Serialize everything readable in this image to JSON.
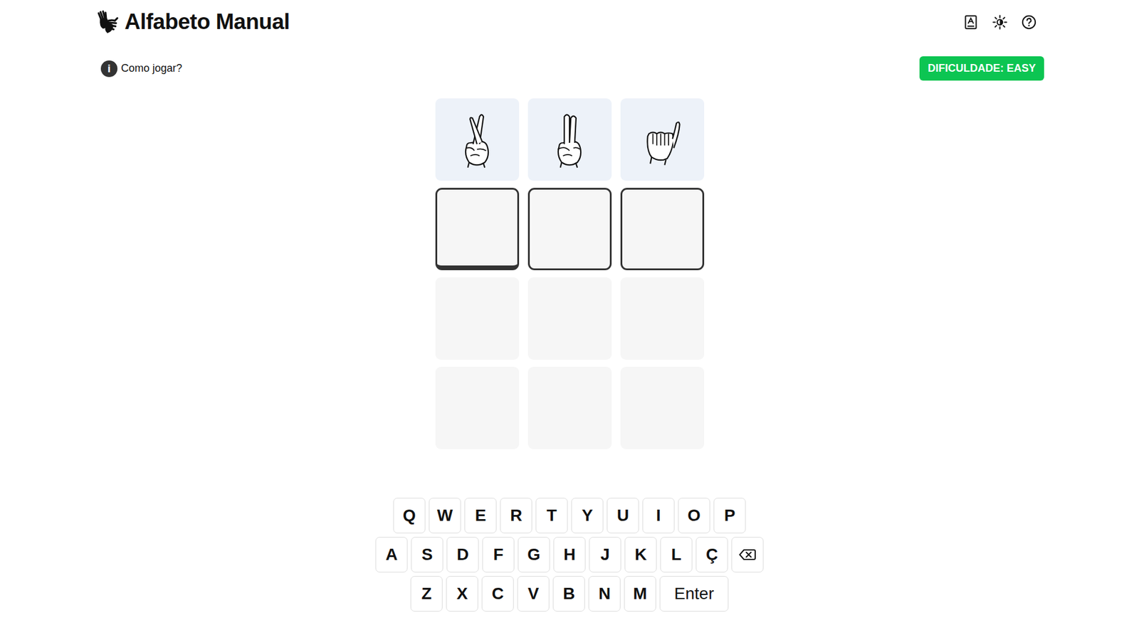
{
  "header": {
    "title": "Alfabeto Manual"
  },
  "help_link": {
    "label": "Como jogar?",
    "icon": "i"
  },
  "difficulty": {
    "label": "DIFICULDADE: EASY"
  },
  "board": {
    "rows": [
      {
        "kind": "hint",
        "tiles": [
          {
            "letter": ""
          },
          {
            "letter": ""
          },
          {
            "letter": ""
          }
        ]
      },
      {
        "kind": "active",
        "tiles": [
          {
            "letter": "",
            "cursor": true
          },
          {
            "letter": "",
            "cursor": false
          },
          {
            "letter": "",
            "cursor": false
          }
        ]
      },
      {
        "kind": "empty",
        "tiles": [
          {
            "letter": ""
          },
          {
            "letter": ""
          },
          {
            "letter": ""
          }
        ]
      },
      {
        "kind": "empty",
        "tiles": [
          {
            "letter": ""
          },
          {
            "letter": ""
          },
          {
            "letter": ""
          }
        ]
      }
    ]
  },
  "keyboard": {
    "rows": [
      [
        {
          "label": "Q",
          "kind": "letter"
        },
        {
          "label": "W",
          "kind": "letter"
        },
        {
          "label": "E",
          "kind": "letter"
        },
        {
          "label": "R",
          "kind": "letter"
        },
        {
          "label": "T",
          "kind": "letter"
        },
        {
          "label": "Y",
          "kind": "letter"
        },
        {
          "label": "U",
          "kind": "letter"
        },
        {
          "label": "I",
          "kind": "letter"
        },
        {
          "label": "O",
          "kind": "letter"
        },
        {
          "label": "P",
          "kind": "letter"
        }
      ],
      [
        {
          "label": "A",
          "kind": "letter"
        },
        {
          "label": "S",
          "kind": "letter"
        },
        {
          "label": "D",
          "kind": "letter"
        },
        {
          "label": "F",
          "kind": "letter"
        },
        {
          "label": "G",
          "kind": "letter"
        },
        {
          "label": "H",
          "kind": "letter"
        },
        {
          "label": "J",
          "kind": "letter"
        },
        {
          "label": "K",
          "kind": "letter"
        },
        {
          "label": "L",
          "kind": "letter"
        },
        {
          "label": "Ç",
          "kind": "letter"
        },
        {
          "label": "",
          "kind": "backspace"
        }
      ],
      [
        {
          "label": "Z",
          "kind": "letter"
        },
        {
          "label": "X",
          "kind": "letter"
        },
        {
          "label": "C",
          "kind": "letter"
        },
        {
          "label": "V",
          "kind": "letter"
        },
        {
          "label": "B",
          "kind": "letter"
        },
        {
          "label": "N",
          "kind": "letter"
        },
        {
          "label": "M",
          "kind": "letter"
        },
        {
          "label": "Enter",
          "kind": "enter"
        }
      ]
    ]
  }
}
